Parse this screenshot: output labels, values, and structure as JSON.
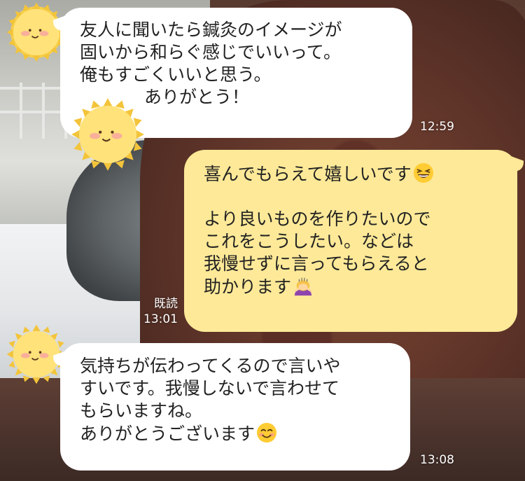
{
  "theme": {
    "incoming_bubble_color": "#ffffff",
    "outgoing_bubble_color": "#fde998",
    "meta_text_color": "#ffffff"
  },
  "messages": [
    {
      "direction": "incoming",
      "avatar_icon": "sun-face-avatar-icon",
      "lines": [
        "友人に聞いたら鍼灸のイメージが",
        "固いから和らぐ感じでいいって。",
        "俺もすごくいいと思う。",
        "ありがとう！"
      ],
      "time": "12:59"
    },
    {
      "direction": "outgoing",
      "lines": [
        "喜んでもらえて嬉しいです",
        "",
        "より良いものを作りたいので",
        "これをこうしたい。などは",
        "我慢せずに言ってもらえると",
        "助かります"
      ],
      "line_emojis": [
        "grinning-squinting-face-icon",
        "person-bowing-icon"
      ],
      "read_label": "既読",
      "time": "13:01"
    },
    {
      "direction": "incoming",
      "avatar_icon": "sun-face-avatar-icon",
      "lines": [
        "気持ちが伝わってくるので言いや",
        "すいです。我慢しないで言わせて",
        "もらいますね。",
        "ありがとうございます"
      ],
      "line_emojis": [
        "smiling-face-icon"
      ],
      "time": "13:08"
    }
  ]
}
